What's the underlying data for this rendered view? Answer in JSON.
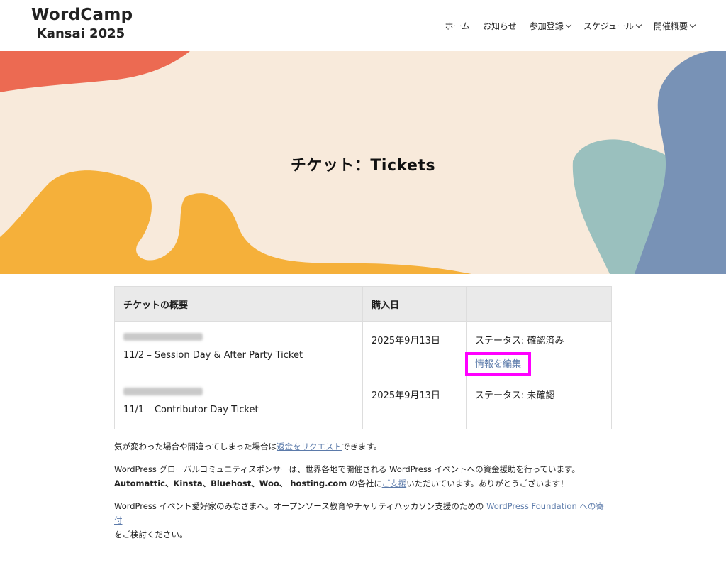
{
  "header": {
    "logo_line1": "WordCamp",
    "logo_line2": "Kansai 2025",
    "nav": [
      {
        "label": "ホーム",
        "has_dropdown": false
      },
      {
        "label": "お知らせ",
        "has_dropdown": false
      },
      {
        "label": "参加登録",
        "has_dropdown": true
      },
      {
        "label": "スケジュール",
        "has_dropdown": true
      },
      {
        "label": "開催概要",
        "has_dropdown": true
      }
    ]
  },
  "hero": {
    "title": "チケット：Tickets",
    "colors": {
      "background": "#f8eadb",
      "red": "#ec6a52",
      "yellow": "#f5b03a",
      "teal": "#9ac0be",
      "blue": "#7892b6"
    }
  },
  "table": {
    "headers": [
      "チケットの概要",
      "購入日",
      ""
    ],
    "rows": [
      {
        "ticket": "11/2 – Session Day & After Party Ticket",
        "date": "2025年9月13日",
        "status": "ステータス: 確認済み",
        "edit_link": "情報を編集"
      },
      {
        "ticket": "11/1 – Contributor Day Ticket",
        "date": "2025年9月13日",
        "status": "ステータス: 未確認"
      }
    ]
  },
  "notes": {
    "refund_before": "気が変わった場合や間違ってしまった場合は",
    "refund_link": "返金をリクエスト",
    "refund_after": "できます。",
    "sponsor_line1": "WordPress グローバルコミュニティスポンサーは、世界各地で開催される WordPress イベントへの資金援助を行っています。",
    "sponsor_names": "Automattic、Kinsta、Bluehost、Woo、 hosting.com",
    "sponsor_mid": " の各社に",
    "sponsor_link": "ご支援",
    "sponsor_after": "いただいています。ありがとうございます！",
    "donate_before": "WordPress イベント愛好家のみなさまへ。オープンソース教育やチャリティハッカソン支援のための ",
    "donate_link": "WordPress Foundation への寄付",
    "donate_after": "をご検討ください。"
  },
  "colors": {
    "link": "#5b7aaa",
    "highlight": "#ff00ff"
  }
}
